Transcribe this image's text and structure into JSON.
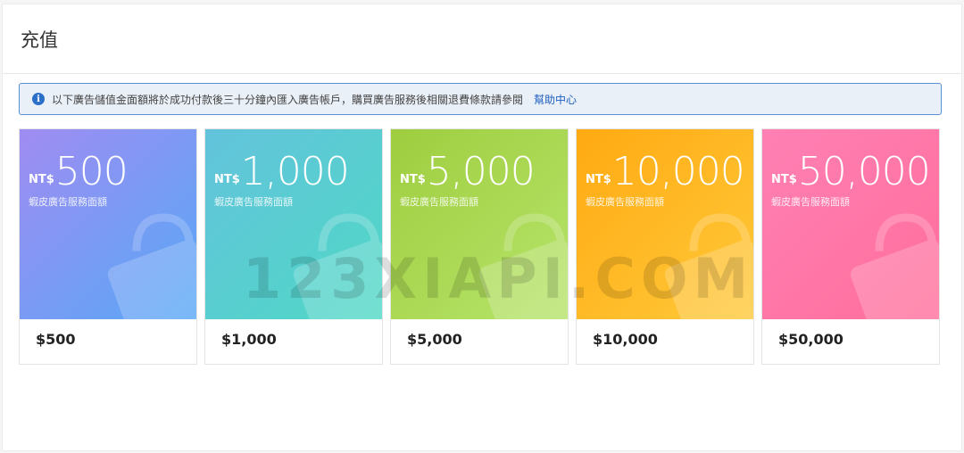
{
  "page": {
    "title": "充值"
  },
  "notice": {
    "icon": "info-icon",
    "text": "以下廣告儲值金面額將於成功付款後三十分鐘內匯入廣告帳戶，購買廣告服務後相關退費條款請參閱",
    "link": "幫助中心"
  },
  "cards": [
    {
      "currency": "NT$",
      "amount": "500",
      "subtitle": "蝦皮廣告服務面額",
      "price": "$500",
      "gradient": [
        "#a08cf2",
        "#57a8f6"
      ]
    },
    {
      "currency": "NT$",
      "amount": "1,000",
      "subtitle": "蝦皮廣告服務面額",
      "price": "$1,000",
      "gradient": [
        "#63c3dc",
        "#4fd8c5"
      ]
    },
    {
      "currency": "NT$",
      "amount": "5,000",
      "subtitle": "蝦皮廣告服務面額",
      "price": "$5,000",
      "gradient": [
        "#9fcd3f",
        "#b6e46a"
      ]
    },
    {
      "currency": "NT$",
      "amount": "10,000",
      "subtitle": "蝦皮廣告服務面額",
      "price": "$10,000",
      "gradient": [
        "#ffaa12",
        "#ffc93a"
      ]
    },
    {
      "currency": "NT$",
      "amount": "50,000",
      "subtitle": "蝦皮廣告服務面額",
      "price": "$50,000",
      "gradient": [
        "#ff80b4",
        "#ff6e9b"
      ]
    }
  ],
  "watermark": "123XIAPI.COM",
  "icons": {
    "card": "shopping-bag-icon"
  }
}
